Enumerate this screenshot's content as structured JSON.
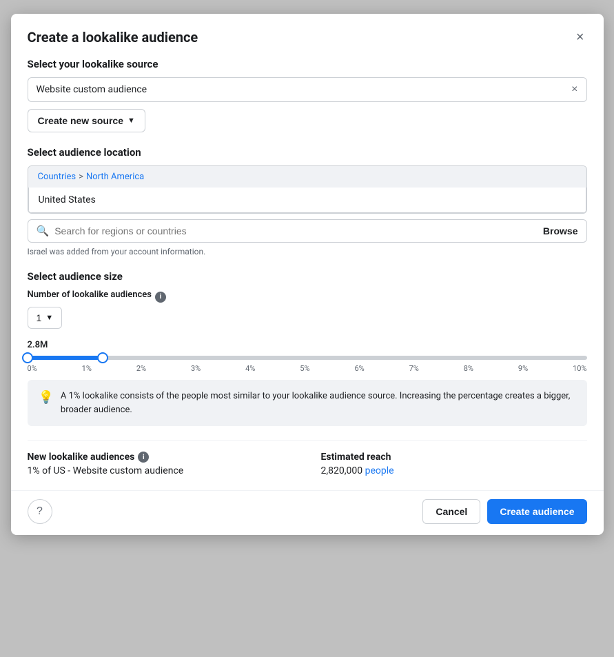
{
  "modal": {
    "title": "Create a lookalike audience",
    "close_label": "×"
  },
  "source_section": {
    "label": "Select your lookalike source",
    "current_value": "Website custom audience",
    "clear_label": "×",
    "create_btn_label": "Create new source"
  },
  "location_section": {
    "label": "Select audience location",
    "breadcrumb_countries": "Countries",
    "breadcrumb_separator": ">",
    "breadcrumb_region": "North America",
    "location_item": "United States",
    "search_placeholder": "Search for regions or countries",
    "browse_label": "Browse",
    "search_note": "Israel was added from your account information."
  },
  "audience_size_section": {
    "label": "Select audience size",
    "sub_label": "Number of lookalike audiences",
    "number_value": "1",
    "slider_value": "2.8M",
    "slider_labels": [
      "0%",
      "1%",
      "2%",
      "3%",
      "4%",
      "5%",
      "6%",
      "7%",
      "8%",
      "9%",
      "10%"
    ],
    "info_text": "A 1% lookalike consists of the people most similar to your lookalike audience source. Increasing the percentage creates a bigger, broader audience."
  },
  "bottom_stats": {
    "new_lookalike_label": "New lookalike audiences",
    "new_lookalike_value": "1% of US - Website custom audience",
    "estimated_reach_label": "Estimated reach",
    "estimated_reach_value": "2,820,000",
    "people_label": "people"
  },
  "footer": {
    "cancel_label": "Cancel",
    "create_label": "Create audience",
    "help_icon": "?"
  }
}
